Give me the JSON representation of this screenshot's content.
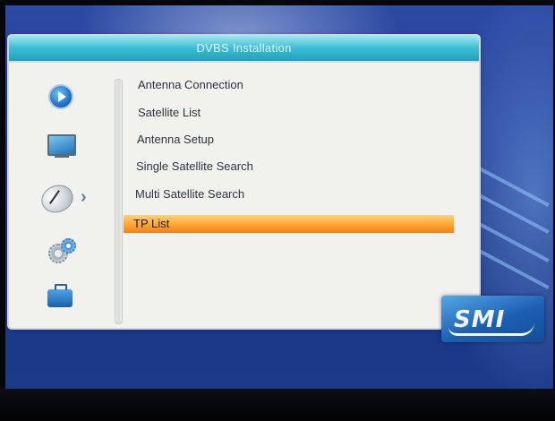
{
  "window": {
    "title": "DVBS Installation"
  },
  "sidebar": {
    "icons": [
      {
        "name": "play-icon",
        "selected": false
      },
      {
        "name": "tv-icon",
        "selected": false
      },
      {
        "name": "satellite-dish-icon",
        "selected": true
      },
      {
        "name": "settings-gears-icon",
        "selected": false
      },
      {
        "name": "toolbox-icon",
        "selected": false
      }
    ],
    "active_indicator_icon": "chevron-right-icon"
  },
  "menu": {
    "items": [
      {
        "label": "Antenna Connection",
        "selected": false
      },
      {
        "label": "Satellite List",
        "selected": false
      },
      {
        "label": "Antenna Setup",
        "selected": false
      },
      {
        "label": "Single Satellite Search",
        "selected": false
      },
      {
        "label": "Multi Satellite Search",
        "selected": false
      },
      {
        "label": "TP List",
        "selected": true
      }
    ]
  },
  "brand": {
    "logo_text": "SMI",
    "logo_is_graphic": true
  },
  "colors": {
    "title_bar": "#3bbdd3",
    "panel_background": "#f1f1ee",
    "selection_highlight": "#ffae3a",
    "screen_background": "#213d95",
    "menu_text": "#2d3340"
  }
}
